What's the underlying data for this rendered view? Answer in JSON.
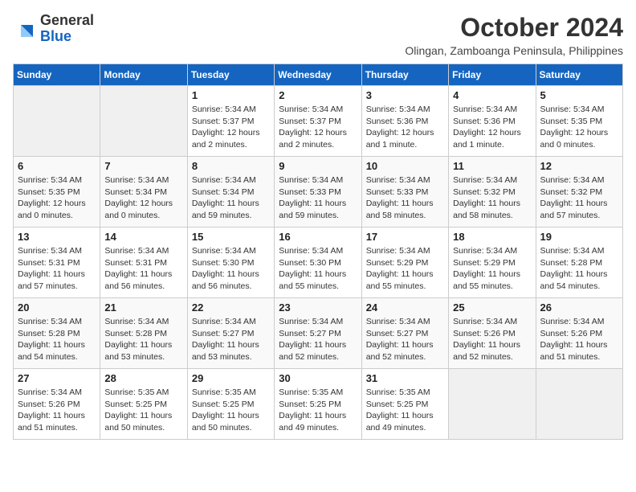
{
  "header": {
    "logo_general": "General",
    "logo_blue": "Blue",
    "month": "October 2024",
    "location": "Olingan, Zamboanga Peninsula, Philippines"
  },
  "days_of_week": [
    "Sunday",
    "Monday",
    "Tuesday",
    "Wednesday",
    "Thursday",
    "Friday",
    "Saturday"
  ],
  "weeks": [
    [
      {
        "day": "",
        "info": ""
      },
      {
        "day": "",
        "info": ""
      },
      {
        "day": "1",
        "info": "Sunrise: 5:34 AM\nSunset: 5:37 PM\nDaylight: 12 hours\nand 2 minutes."
      },
      {
        "day": "2",
        "info": "Sunrise: 5:34 AM\nSunset: 5:37 PM\nDaylight: 12 hours\nand 2 minutes."
      },
      {
        "day": "3",
        "info": "Sunrise: 5:34 AM\nSunset: 5:36 PM\nDaylight: 12 hours\nand 1 minute."
      },
      {
        "day": "4",
        "info": "Sunrise: 5:34 AM\nSunset: 5:36 PM\nDaylight: 12 hours\nand 1 minute."
      },
      {
        "day": "5",
        "info": "Sunrise: 5:34 AM\nSunset: 5:35 PM\nDaylight: 12 hours\nand 0 minutes."
      }
    ],
    [
      {
        "day": "6",
        "info": "Sunrise: 5:34 AM\nSunset: 5:35 PM\nDaylight: 12 hours\nand 0 minutes."
      },
      {
        "day": "7",
        "info": "Sunrise: 5:34 AM\nSunset: 5:34 PM\nDaylight: 12 hours\nand 0 minutes."
      },
      {
        "day": "8",
        "info": "Sunrise: 5:34 AM\nSunset: 5:34 PM\nDaylight: 11 hours\nand 59 minutes."
      },
      {
        "day": "9",
        "info": "Sunrise: 5:34 AM\nSunset: 5:33 PM\nDaylight: 11 hours\nand 59 minutes."
      },
      {
        "day": "10",
        "info": "Sunrise: 5:34 AM\nSunset: 5:33 PM\nDaylight: 11 hours\nand 58 minutes."
      },
      {
        "day": "11",
        "info": "Sunrise: 5:34 AM\nSunset: 5:32 PM\nDaylight: 11 hours\nand 58 minutes."
      },
      {
        "day": "12",
        "info": "Sunrise: 5:34 AM\nSunset: 5:32 PM\nDaylight: 11 hours\nand 57 minutes."
      }
    ],
    [
      {
        "day": "13",
        "info": "Sunrise: 5:34 AM\nSunset: 5:31 PM\nDaylight: 11 hours\nand 57 minutes."
      },
      {
        "day": "14",
        "info": "Sunrise: 5:34 AM\nSunset: 5:31 PM\nDaylight: 11 hours\nand 56 minutes."
      },
      {
        "day": "15",
        "info": "Sunrise: 5:34 AM\nSunset: 5:30 PM\nDaylight: 11 hours\nand 56 minutes."
      },
      {
        "day": "16",
        "info": "Sunrise: 5:34 AM\nSunset: 5:30 PM\nDaylight: 11 hours\nand 55 minutes."
      },
      {
        "day": "17",
        "info": "Sunrise: 5:34 AM\nSunset: 5:29 PM\nDaylight: 11 hours\nand 55 minutes."
      },
      {
        "day": "18",
        "info": "Sunrise: 5:34 AM\nSunset: 5:29 PM\nDaylight: 11 hours\nand 55 minutes."
      },
      {
        "day": "19",
        "info": "Sunrise: 5:34 AM\nSunset: 5:28 PM\nDaylight: 11 hours\nand 54 minutes."
      }
    ],
    [
      {
        "day": "20",
        "info": "Sunrise: 5:34 AM\nSunset: 5:28 PM\nDaylight: 11 hours\nand 54 minutes."
      },
      {
        "day": "21",
        "info": "Sunrise: 5:34 AM\nSunset: 5:28 PM\nDaylight: 11 hours\nand 53 minutes."
      },
      {
        "day": "22",
        "info": "Sunrise: 5:34 AM\nSunset: 5:27 PM\nDaylight: 11 hours\nand 53 minutes."
      },
      {
        "day": "23",
        "info": "Sunrise: 5:34 AM\nSunset: 5:27 PM\nDaylight: 11 hours\nand 52 minutes."
      },
      {
        "day": "24",
        "info": "Sunrise: 5:34 AM\nSunset: 5:27 PM\nDaylight: 11 hours\nand 52 minutes."
      },
      {
        "day": "25",
        "info": "Sunrise: 5:34 AM\nSunset: 5:26 PM\nDaylight: 11 hours\nand 52 minutes."
      },
      {
        "day": "26",
        "info": "Sunrise: 5:34 AM\nSunset: 5:26 PM\nDaylight: 11 hours\nand 51 minutes."
      }
    ],
    [
      {
        "day": "27",
        "info": "Sunrise: 5:34 AM\nSunset: 5:26 PM\nDaylight: 11 hours\nand 51 minutes."
      },
      {
        "day": "28",
        "info": "Sunrise: 5:35 AM\nSunset: 5:25 PM\nDaylight: 11 hours\nand 50 minutes."
      },
      {
        "day": "29",
        "info": "Sunrise: 5:35 AM\nSunset: 5:25 PM\nDaylight: 11 hours\nand 50 minutes."
      },
      {
        "day": "30",
        "info": "Sunrise: 5:35 AM\nSunset: 5:25 PM\nDaylight: 11 hours\nand 49 minutes."
      },
      {
        "day": "31",
        "info": "Sunrise: 5:35 AM\nSunset: 5:25 PM\nDaylight: 11 hours\nand 49 minutes."
      },
      {
        "day": "",
        "info": ""
      },
      {
        "day": "",
        "info": ""
      }
    ]
  ]
}
